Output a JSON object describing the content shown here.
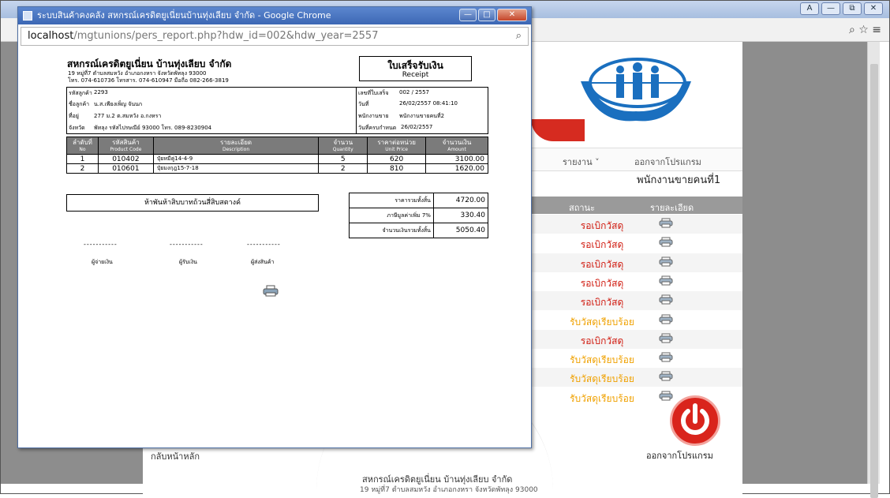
{
  "background": {
    "address_right": "⌕ ☆ ≡",
    "window_controls": [
      "A",
      "—",
      "⧉",
      "✕"
    ],
    "menu": {
      "item1": "รายงาน ˅",
      "item2": "ออกจากโปรแกรม"
    },
    "staff_label": "พนักงานขายคนที่1",
    "table_headers": {
      "status": "สถานะ",
      "detail": "รายละเอียด"
    },
    "rows": [
      {
        "status": "รอเบิกวัสดุ",
        "color": "#d01a0f"
      },
      {
        "status": "รอเบิกวัสดุ",
        "color": "#d01a0f"
      },
      {
        "status": "รอเบิกวัสดุ",
        "color": "#d01a0f"
      },
      {
        "status": "รอเบิกวัสดุ",
        "color": "#d01a0f"
      },
      {
        "status": "รอเบิกวัสดุ",
        "color": "#d01a0f"
      },
      {
        "status": "รับวัสดุเรียบร้อย",
        "color": "#f0a100"
      },
      {
        "status": "รอเบิกวัสดุ",
        "color": "#d01a0f"
      },
      {
        "status": "รับวัสดุเรียบร้อย",
        "color": "#f0a100"
      },
      {
        "status": "รับวัสดุเรียบร้อย",
        "color": "#f0a100"
      },
      {
        "status": "รับวัสดุเรียบร้อย",
        "color": "#f0a100"
      }
    ],
    "power_label": "ออกจากโปรแกรม",
    "left_label": "กลับหน้าหลัก",
    "footer_org": "สหกรณ์เครดิตยูเนี่ยน บ้านทุ่งเลียบ จำกัด",
    "footer_addr": "19 หมู่ที่7 ตำบลสมหวัง อำเภอกงหรา จังหวัดพัทลุง 93000"
  },
  "popup": {
    "title": "ระบบสินค้าคงคลัง สหกรณ์เครดิตยูเนี่ยนบ้านทุ่งเลียบ จำกัด - Google Chrome",
    "url_host": "localhost",
    "url_path": "/mgtunions/pers_report.php?hdw_id=002&hdw_year=2557",
    "zoom_icon": "⌕",
    "controls": [
      "—",
      "□",
      "✕"
    ]
  },
  "receipt": {
    "org_name": "สหกรณ์เครดิตยูเนี่ยน บ้านทุ่งเลียบ จำกัด",
    "org_address": "19 หมู่ที่7 ตำบลสมหวัง อำเภอกงหรา จังหวัดพัทลุง 93000",
    "org_phone": "โทร. 074-610736 โทรสาร. 074-610947 มือถือ 082-266-3819",
    "title_th": "ใบเสร็จรับเงิน",
    "title_en": "Receipt",
    "customer": {
      "code_label": "รหัสลูกค้า",
      "code": "2293",
      "name_label": "ชื่อลูกค้า",
      "name": "น.ส.เพียงเพ็ญ จันนก",
      "address_label": "ที่อยู่",
      "address": "277 ม.2 ต.สมหวัง อ.กงหรา",
      "province_label": "จังหวัด",
      "province": "พัทลุง  รหัสไปรษณีย์ 93000 โทร. 089-8230904"
    },
    "meta": {
      "no_label": "เลขที่ใบเสร็จ",
      "no": "002 / 2557",
      "date_label": "วันที่",
      "date": "26/02/2557  08:41:10",
      "seller_label": "พนักงานขาย",
      "seller": "พนักงานขายคนที่2",
      "due_label": "วันที่ครบกำหนด",
      "due": "26/02/2557"
    },
    "columns": [
      {
        "th": "ลำดับที่",
        "en": "No"
      },
      {
        "th": "รหัสสินค้า",
        "en": "Product Code"
      },
      {
        "th": "รายละเอียด",
        "en": "Description"
      },
      {
        "th": "จำนวน",
        "en": "Quantity"
      },
      {
        "th": "ราคาต่อหน่วย",
        "en": "Unit Price"
      },
      {
        "th": "จำนวนเงิน",
        "en": "Amount"
      }
    ],
    "items": [
      {
        "no": "1",
        "code": "010402",
        "desc": "ปุ๋ยหมีคู่14-4-9",
        "qty": "5",
        "price": "620",
        "amount": "3100.00"
      },
      {
        "no": "2",
        "code": "010601",
        "desc": "ปุ๋ยมงกุฎ15-7-18",
        "qty": "2",
        "price": "810",
        "amount": "1620.00"
      }
    ],
    "amount_words": "ห้าพันห้าสิบบาทถ้วนสี่สิบสตางค์",
    "totals": [
      {
        "label": "ราคารวมทั้งสิ้น",
        "value": "4720.00"
      },
      {
        "label": "ภาษีมูลค่าเพิ่ม 7%",
        "value": "330.40"
      },
      {
        "label": "จำนวนเงินรวมทั้งสิ้น",
        "value": "5050.40"
      }
    ],
    "signatures": {
      "dash": "-----------",
      "payer": "ผู้จ่ายเงิน",
      "receiver": "ผู้รับเงิน",
      "deliverer": "ผู้ส่งสินค้า"
    }
  }
}
